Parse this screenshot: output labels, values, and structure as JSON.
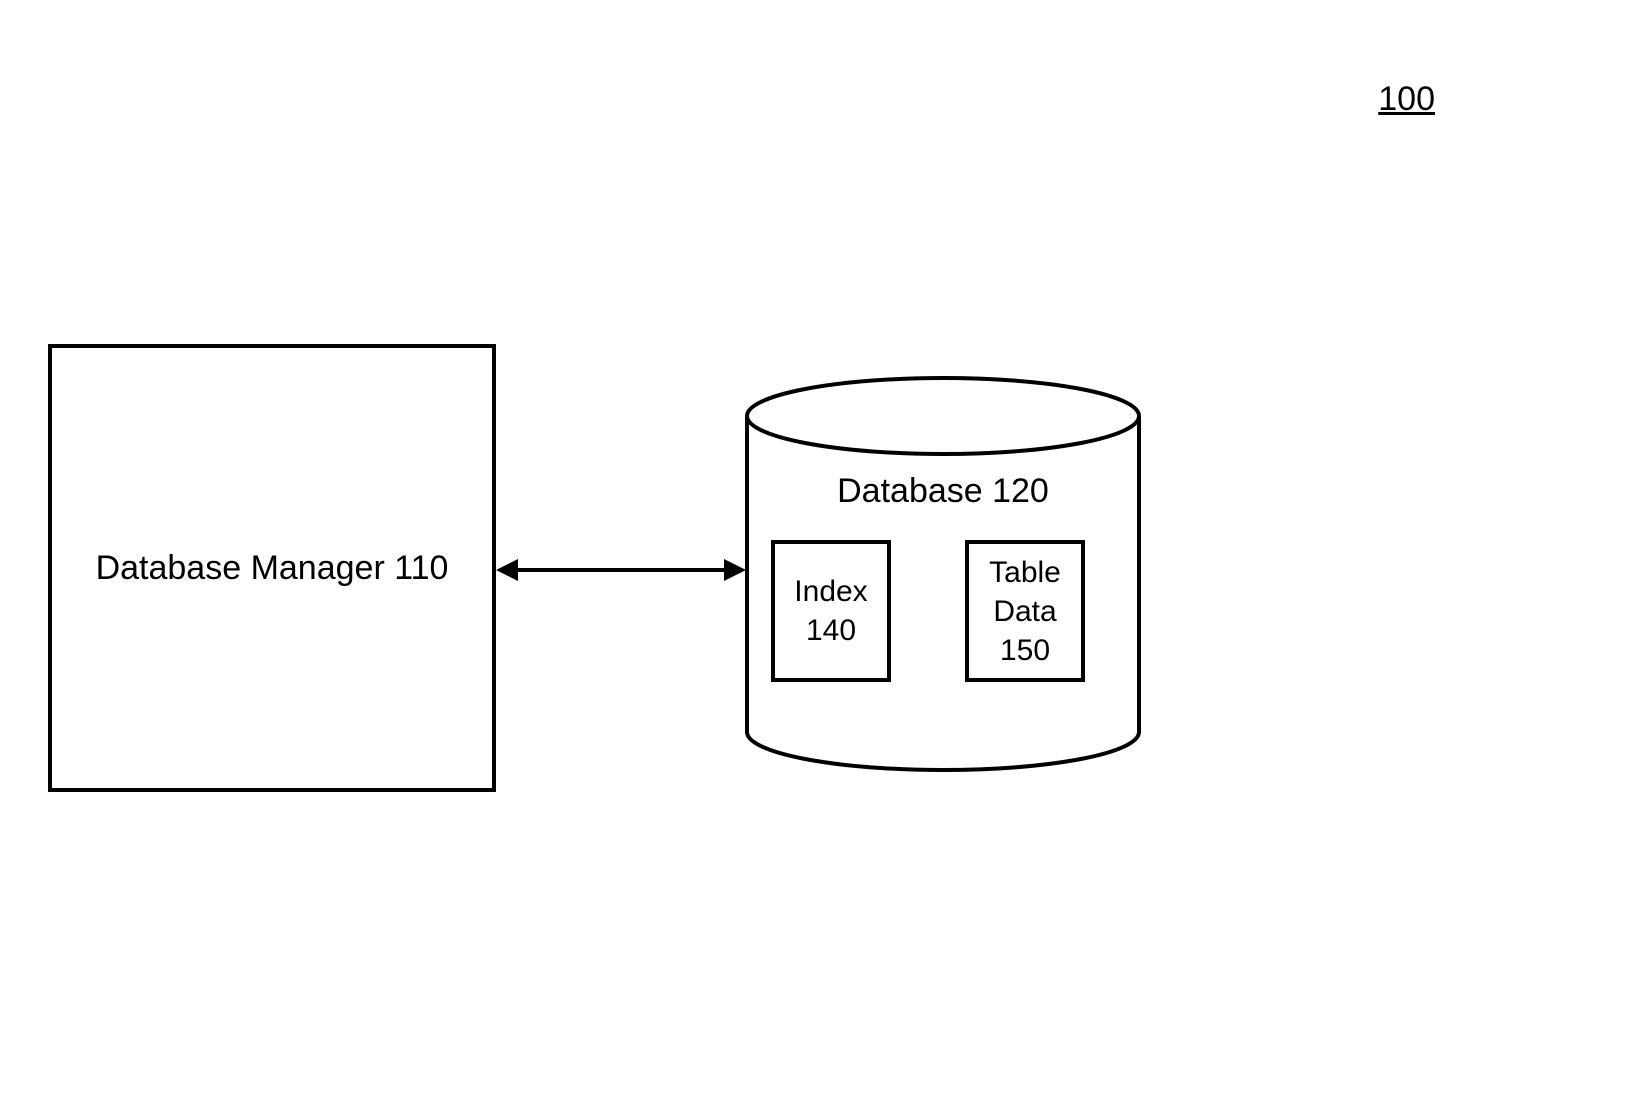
{
  "figure_number": "100",
  "db_manager": {
    "label": "Database Manager 110"
  },
  "database": {
    "label": "Database 120",
    "index": {
      "label": "Index\n140"
    },
    "table_data": {
      "label": "Table\nData\n150"
    }
  }
}
